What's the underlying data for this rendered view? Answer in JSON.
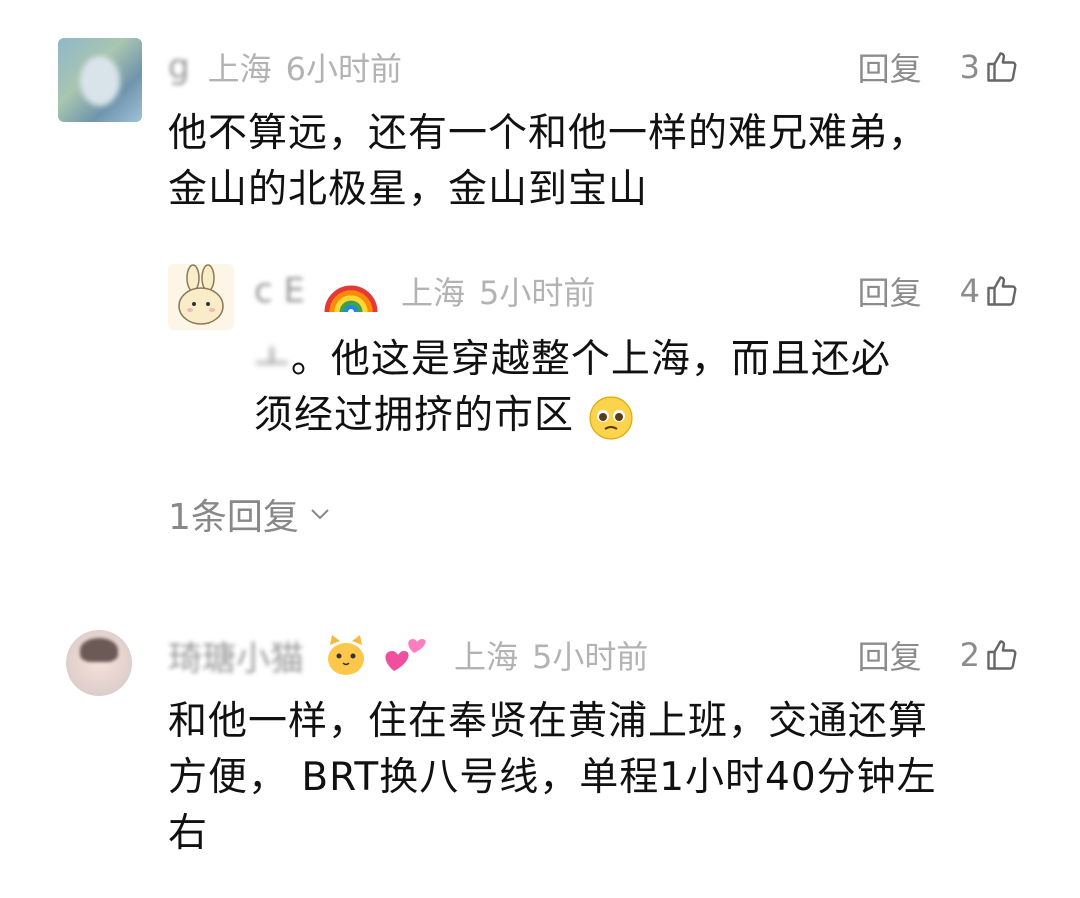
{
  "comments": [
    {
      "name": "g",
      "location": "上海",
      "time": "6小时前",
      "reply_label": "回复",
      "likes": "3",
      "text_line1": "他不算远，还有一个和他一样的难兄难弟，",
      "text_line2": "金山的北极星，金山到宝山",
      "replies": [
        {
          "name": "c      E",
          "location": "上海",
          "time": "5小时前",
          "reply_label": "回复",
          "likes": "4",
          "text_line1_prefix": "ㅗ",
          "text_line1": "。他这是穿越整个上海，而且还必",
          "text_line2": "须经过拥挤的市区"
        }
      ],
      "more_replies_label": "1条回复"
    },
    {
      "name": "琦瑭小猫",
      "location": "上海",
      "time": "5小时前",
      "reply_label": "回复",
      "likes": "2",
      "text_line1": "和他一样，住在奉贤在黄浦上班，交通还算",
      "text_line2": "方便， BRT换八号线，单程1小时40分钟左",
      "text_line3": "右"
    }
  ],
  "colors": {
    "meta": "#b3b3b3",
    "action": "#8c8c8c",
    "text": "#111111"
  },
  "icons": {
    "like": "thumbs-up-outline-icon",
    "chevron": "chevron-down-icon",
    "rainbow": "rainbow-emoji",
    "cat": "cat-face-emoji",
    "hearts": "two-hearts-emoji",
    "pleading": "pleading-face-emoji"
  }
}
